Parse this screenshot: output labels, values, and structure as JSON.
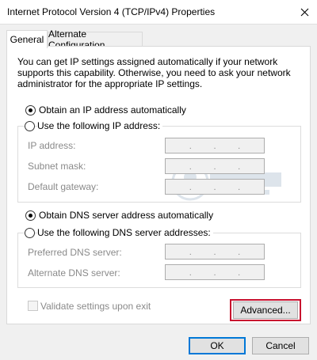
{
  "window": {
    "title": "Internet Protocol Version 4 (TCP/IPv4) Properties",
    "close_glyph": "✕"
  },
  "tabs": [
    {
      "label": "General",
      "active": true
    },
    {
      "label": "Alternate Configuration",
      "active": false
    }
  ],
  "description": "You can get IP settings assigned automatically if your network supports this capability. Otherwise, you need to ask your network administrator for the appropriate IP settings.",
  "ip": {
    "auto_label": "Obtain an IP address automatically",
    "manual_label": "Use the following IP address:",
    "selected": "auto",
    "fields": [
      {
        "label": "IP address:"
      },
      {
        "label": "Subnet mask:"
      },
      {
        "label": "Default gateway:"
      }
    ]
  },
  "dns": {
    "auto_label": "Obtain DNS server address automatically",
    "manual_label": "Use the following DNS server addresses:",
    "selected": "auto",
    "fields": [
      {
        "label": "Preferred DNS server:"
      },
      {
        "label": "Alternate DNS server:"
      }
    ]
  },
  "validate": {
    "label": "Validate settings upon exit",
    "checked": false
  },
  "buttons": {
    "advanced": "Advanced...",
    "ok": "OK",
    "cancel": "Cancel"
  },
  "ip_separator": ".",
  "colors": {
    "highlight": "#c8102e",
    "default_button_border": "#0078d7"
  }
}
